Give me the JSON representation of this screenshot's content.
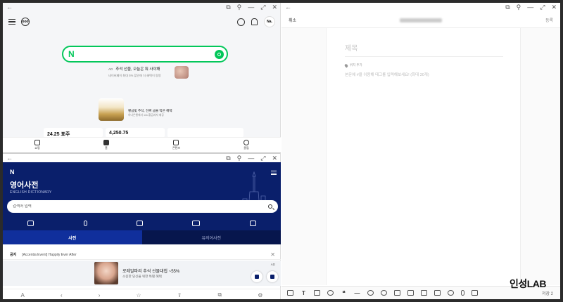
{
  "naver_pane": {
    "window_controls": [
      "⧉",
      "⚲",
      "—",
      "⤢",
      "✕"
    ],
    "back_arrow": "←",
    "avatar_text": "Na.",
    "logo_text": "ooo",
    "search_logo": "N",
    "ad": {
      "badge": "AD",
      "line1": "추석 선물, 오늘은 뭐 사야해",
      "line2": "네이버페이 최대 5% 할인에 더 혜택이 팡팡"
    },
    "promo": {
      "title": "황금빛 추석, 진짜 금을 먹은 혜택",
      "subtitle": "하나은행에서 11k 황금과자 제공"
    },
    "cards": [
      "24.25 표주",
      "4,250.75",
      ""
    ],
    "bottom_nav": [
      {
        "label": "쇼핑"
      },
      {
        "label": "홈"
      },
      {
        "label": "콘텐츠"
      },
      {
        "label": "클립"
      }
    ]
  },
  "dict_pane": {
    "window_controls": [
      "⧉",
      "⚲",
      "—",
      "⤢",
      "✕"
    ],
    "back_arrow": "←",
    "logo": "N",
    "title": "영어사전",
    "subtitle": "ENGLISH DICTIONARY",
    "search_placeholder": "검색어 입력",
    "tabs": [
      {
        "label": "사전",
        "active": true
      },
      {
        "label": "유의어사전",
        "active": false
      }
    ],
    "notice": {
      "label": "공지",
      "text": "[Accentia Event] Happily Ever After",
      "close": "✕"
    },
    "ad": {
      "tag": "AD",
      "line1": "로레알파리 추석 선물대첩 ~55%",
      "line2": "소중한 당신을 위한 특별 혜택"
    },
    "bottom_bar": [
      "A",
      "‹",
      "›",
      "☆",
      "⇪",
      "⧉",
      "⚙"
    ]
  },
  "blog_pane": {
    "window_controls": [
      "⧉",
      "⚲",
      "—",
      "⤢",
      "✕"
    ],
    "back_arrow": "←",
    "cancel_label": "취소",
    "publish_label": "등록",
    "title_placeholder": "제목",
    "location_label": "위치 추가",
    "body_placeholder": "본문에 #을 이용해 태그를 입력해보세요! (최대 30개)",
    "toolbar_items": [
      "camera",
      "T",
      "align",
      "sticker",
      "❝",
      "—",
      "pin",
      "link",
      "clip",
      "table",
      "grid",
      "spell",
      "ai",
      "mic",
      "chat"
    ],
    "save_label": "저장",
    "save_count": "2"
  },
  "watermark": "인성LAB",
  "colors": {
    "naver_green": "#03c75a",
    "dict_navy": "#0a1f6b",
    "dict_tab_active": "#102f9c"
  }
}
